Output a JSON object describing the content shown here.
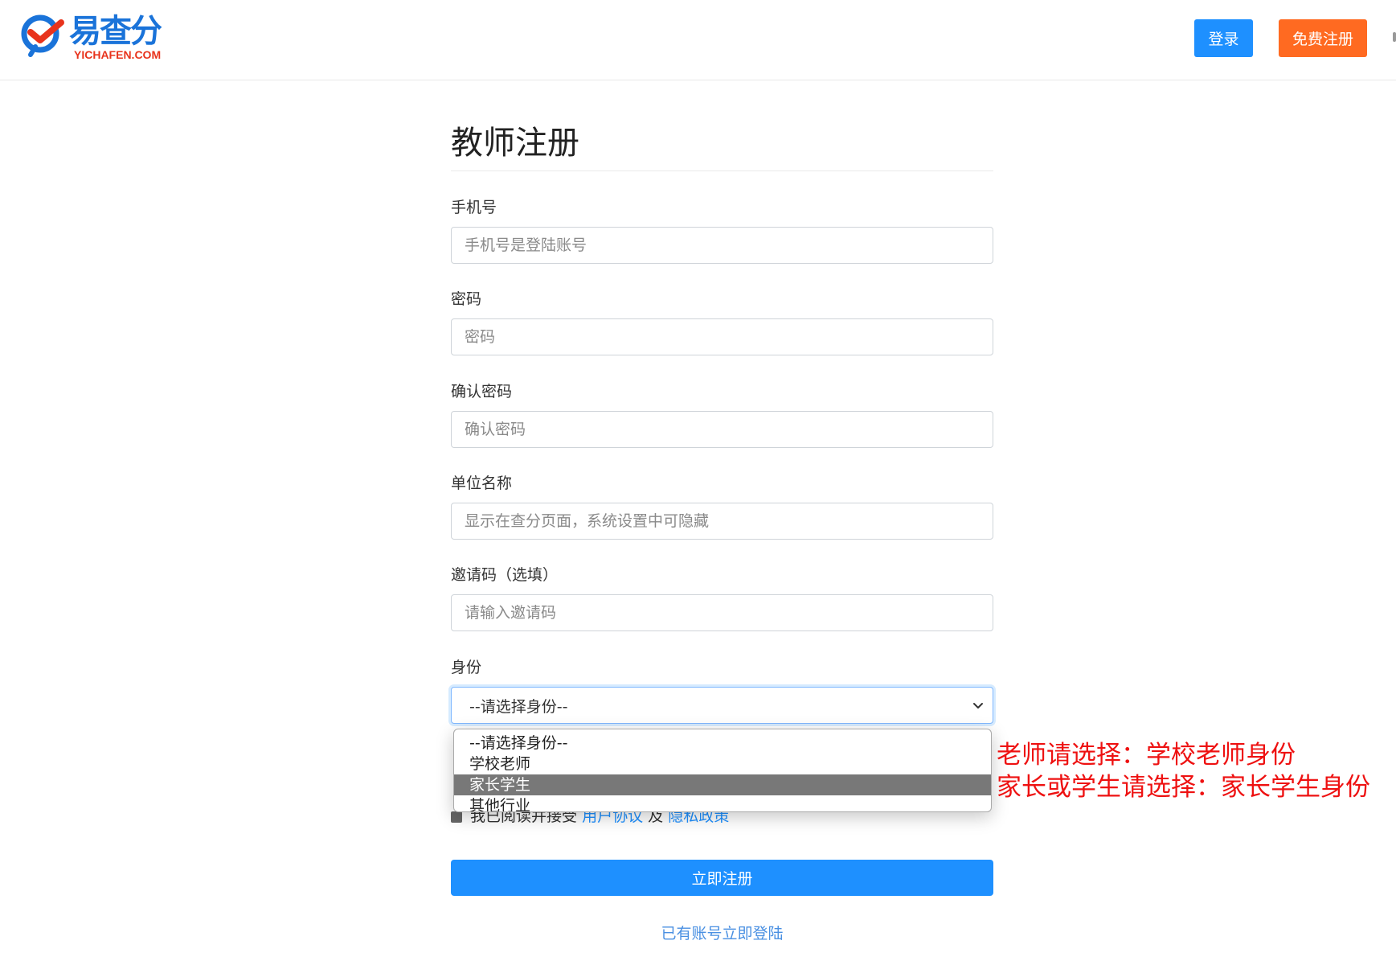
{
  "header": {
    "logo_text": "易查分",
    "logo_sub": "YICHAFEN.COM",
    "login_button": "登录",
    "register_button": "免费注册"
  },
  "form": {
    "title": "教师注册",
    "phone": {
      "label": "手机号",
      "placeholder": "手机号是登陆账号"
    },
    "password": {
      "label": "密码",
      "placeholder": "密码"
    },
    "confirm_password": {
      "label": "确认密码",
      "placeholder": "确认密码"
    },
    "organization": {
      "label": "单位名称",
      "placeholder": "显示在查分页面，系统设置中可隐藏"
    },
    "invite_code": {
      "label": "邀请码（选填）",
      "placeholder": "请输入邀请码"
    },
    "identity": {
      "label": "身份",
      "selected": "--请选择身份--",
      "options": [
        "--请选择身份--",
        "学校老师",
        "家长学生",
        "其他行业"
      ],
      "highlighted_option": "家长学生"
    },
    "agreement": {
      "text_before": "我已阅读并接受",
      "terms_link": "用户协议",
      "and": "及",
      "privacy_link": "隐私政策"
    },
    "submit_button": "立即注册",
    "login_link": "已有账号立即登陆"
  },
  "annotations": {
    "line1": "老师请选择：学校老师身份",
    "line2": "家长或学生请选择：家长学生身份"
  },
  "colors": {
    "primary": "#1e90ff",
    "register_orange": "#ff6a21",
    "annotation_red": "#ee1111",
    "highlight_gray": "#787878"
  }
}
